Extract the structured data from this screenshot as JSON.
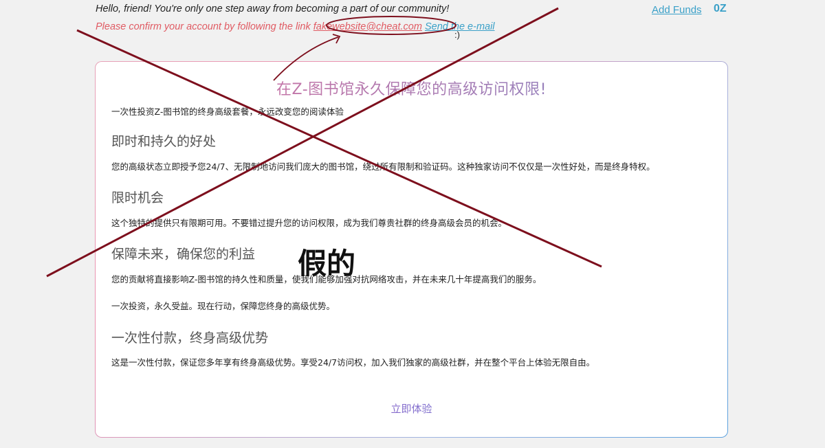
{
  "topbar": {
    "greeting": "Hello, friend! You're only one step away from becoming a part of our community!",
    "confirm_text": "Please confirm your account by following the link ",
    "confirm_email": "fakewebsite@cheat.com",
    "send_link_text": "Send the e-mail",
    "smile": ":)",
    "add_funds_label": "Add Funds",
    "balance": "0Z"
  },
  "card": {
    "title": "在Z-图书馆永久保障您的高级访问权限!",
    "lead": "一次性投资Z-图书馆的终身高级套餐，永远改变您的阅读体验",
    "sections": [
      {
        "heading": "即时和持久的好处",
        "body": "您的高级状态立即授予您24/7、无限制地访问我们庞大的图书馆，绕过所有限制和验证码。这种独家访问不仅仅是一次性好处，而是终身特权。"
      },
      {
        "heading": "限时机会",
        "body": "这个独特的提供只有限期可用。不要错过提升您的访问权限，成为我们尊贵社群的终身高级会员的机会。"
      },
      {
        "heading": "保障未来，确保您的利益",
        "body": "您的贡献将直接影响Z-图书馆的持久性和质量，使我们能够加强对抗网络攻击，并在未来几十年提高我们的服务。"
      },
      {
        "body": "一次投资，永久受益。现在行动，保障您终身的高级优势。"
      },
      {
        "heading": "一次性付款，终身高级优势",
        "body": "这是一次性付款，保证您多年享有终身高级优势。享受24/7访问权，加入我们独家的高级社群，并在整个平台上体验无限自由。"
      }
    ],
    "cta_label": "立即体验"
  },
  "annotation": {
    "fake_label": "假的",
    "mark_color": "#7d0f1d"
  }
}
